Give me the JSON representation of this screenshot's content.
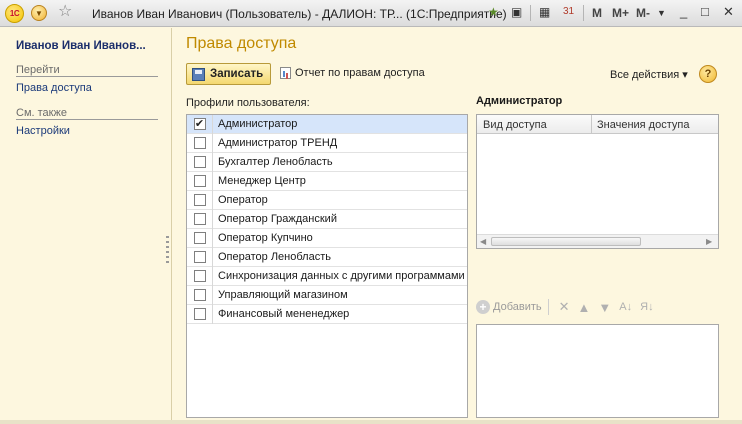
{
  "window": {
    "title": "Иванов Иван Иванович (Пользователь) - ДАЛИОН: ТР... (1С:Предприятие)",
    "logo_text": "1С",
    "toolbar_m": [
      "M",
      "M+",
      "M-"
    ],
    "controls": [
      "_",
      "□",
      "✕"
    ]
  },
  "sidebar": {
    "user_name": "Иванов Иван Иванов...",
    "goto_header": "Перейти",
    "goto_items": [
      "Права доступа"
    ],
    "see_also_header": "См. также",
    "see_also_items": [
      "Настройки"
    ]
  },
  "main": {
    "page_title": "Права доступа",
    "save_label": "Записать",
    "report_label": "Отчет по правам доступа",
    "all_actions_label": "Все действия ▾",
    "help_label": "?",
    "profiles_label": "Профили пользователя:",
    "profiles": [
      {
        "label": "Администратор",
        "checked": true
      },
      {
        "label": "Администратор ТРЕНД",
        "checked": false
      },
      {
        "label": "Бухгалтер Ленобласть",
        "checked": false
      },
      {
        "label": "Менеджер Центр",
        "checked": false
      },
      {
        "label": "Оператор",
        "checked": false
      },
      {
        "label": "Оператор Гражданский",
        "checked": false
      },
      {
        "label": "Оператор Купчино",
        "checked": false
      },
      {
        "label": "Оператор Ленобласть",
        "checked": false
      },
      {
        "label": "Синхронизация данных с другими программами",
        "checked": false
      },
      {
        "label": "Управляющий магазином",
        "checked": false
      },
      {
        "label": "Финансовый мененеджер",
        "checked": false
      }
    ],
    "selected_profile_heading": "Администратор",
    "access_columns": [
      "Вид доступа",
      "Значения доступа"
    ],
    "add_label": "Добавить"
  }
}
